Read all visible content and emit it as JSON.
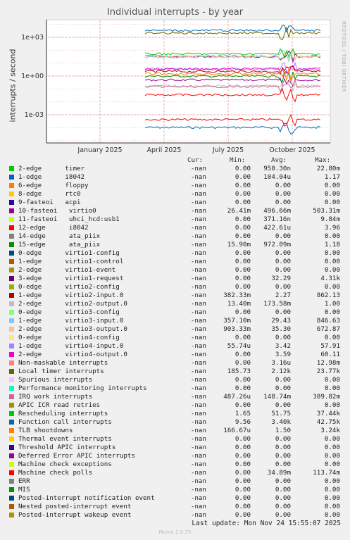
{
  "title": "Individual interrupts - by year",
  "side_label": "RRDTOOL / TOBI OETIKER",
  "footer": "Last update: Mon Nov 24 15:55:07 2025",
  "version": "Munin 2.0.75",
  "legend_headers": {
    "cur": "Cur:",
    "min": "Min:",
    "avg": "Avg:",
    "max": "Max:"
  },
  "chart_data": {
    "type": "line",
    "title": "Individual interrupts - by year",
    "ylabel": "interrupts / second",
    "yscale": "log",
    "yticks": [
      "1e+03",
      "1e+00",
      "1e-03"
    ],
    "xticks": [
      "January 2025",
      "April 2025",
      "July 2025",
      "October 2025"
    ],
    "grid": true,
    "series": [
      {
        "name": "2-edge      timer",
        "color": "#00cc00",
        "cur": "-nan",
        "min": "0.00",
        "avg": "950.30n",
        "max": "22.80m"
      },
      {
        "name": "1-edge      i8042",
        "color": "#0066b3",
        "cur": "-nan",
        "min": "0.00",
        "avg": "104.04u",
        "max": "1.17"
      },
      {
        "name": "6-edge      floppy",
        "color": "#ff8000",
        "cur": "-nan",
        "min": "0.00",
        "avg": "0.00",
        "max": "0.00"
      },
      {
        "name": "8-edge      rtc0",
        "color": "#ffcc00",
        "cur": "-nan",
        "min": "0.00",
        "avg": "0.00",
        "max": "0.00"
      },
      {
        "name": "9-fasteoi   acpi",
        "color": "#330099",
        "cur": "-nan",
        "min": "0.00",
        "avg": "0.00",
        "max": "0.00"
      },
      {
        "name": "10-fasteoi   virtio0",
        "color": "#990099",
        "cur": "-nan",
        "min": "26.41m",
        "avg": "496.66m",
        "max": "503.31m"
      },
      {
        "name": "11-fasteoi   uhci_hcd:usb1",
        "color": "#ccff00",
        "cur": "-nan",
        "min": "0.00",
        "avg": "371.16n",
        "max": "9.84m"
      },
      {
        "name": "12-edge      i8042",
        "color": "#ff0000",
        "cur": "-nan",
        "min": "0.00",
        "avg": "422.61u",
        "max": "3.96"
      },
      {
        "name": "14-edge      ata_piix",
        "color": "#808080",
        "cur": "-nan",
        "min": "0.00",
        "avg": "0.00",
        "max": "0.00"
      },
      {
        "name": "15-edge      ata_piix",
        "color": "#008f00",
        "cur": "-nan",
        "min": "15.90m",
        "avg": "972.09m",
        "max": "1.18"
      },
      {
        "name": "0-edge      virtio1-config",
        "color": "#00487d",
        "cur": "-nan",
        "min": "0.00",
        "avg": "0.00",
        "max": "0.00"
      },
      {
        "name": "1-edge      virtio1-control",
        "color": "#b35a00",
        "cur": "-nan",
        "min": "0.00",
        "avg": "0.00",
        "max": "0.00"
      },
      {
        "name": "2-edge      virtio1-event",
        "color": "#b38f00",
        "cur": "-nan",
        "min": "0.00",
        "avg": "0.00",
        "max": "0.00"
      },
      {
        "name": "3-edge      virtio1-request",
        "color": "#6b006b",
        "cur": "-nan",
        "min": "0.00",
        "avg": "32.29",
        "max": "4.31k"
      },
      {
        "name": "0-edge      virtio2-config",
        "color": "#8fb300",
        "cur": "-nan",
        "min": "0.00",
        "avg": "0.00",
        "max": "0.00"
      },
      {
        "name": "1-edge      virtio2-input.0",
        "color": "#b30000",
        "cur": "-nan",
        "min": "382.33m",
        "avg": "2.27",
        "max": "862.13"
      },
      {
        "name": "2-edge      virtio2-output.0",
        "color": "#bebebe",
        "cur": "-nan",
        "min": "13.40m",
        "avg": "173.58m",
        "max": "1.00"
      },
      {
        "name": "0-edge      virtio3-config",
        "color": "#80ff80",
        "cur": "-nan",
        "min": "0.00",
        "avg": "0.00",
        "max": "0.00"
      },
      {
        "name": "1-edge      virtio3-input.0",
        "color": "#80c9ff",
        "cur": "-nan",
        "min": "357.10m",
        "avg": "29.43",
        "max": "846.63"
      },
      {
        "name": "2-edge      virtio3-output.0",
        "color": "#ffc080",
        "cur": "-nan",
        "min": "903.33m",
        "avg": "35.30",
        "max": "672.87"
      },
      {
        "name": "0-edge      virtio4-config",
        "color": "#ffe680",
        "cur": "-nan",
        "min": "0.00",
        "avg": "0.00",
        "max": "0.00"
      },
      {
        "name": "1-edge      virtio4-input.0",
        "color": "#aa80ff",
        "cur": "-nan",
        "min": "55.74u",
        "avg": "3.42",
        "max": "57.91"
      },
      {
        "name": "2-edge      virtio4-output.0",
        "color": "#ee00cc",
        "cur": "-nan",
        "min": "0.00",
        "avg": "3.59",
        "max": "60.11"
      },
      {
        "name": "Non-maskable interrupts",
        "color": "#ff8080",
        "cur": "-nan",
        "min": "0.00",
        "avg": "3.16u",
        "max": "12.98m"
      },
      {
        "name": "Local timer interrupts",
        "color": "#666600",
        "cur": "-nan",
        "min": "185.73",
        "avg": "2.12k",
        "max": "23.77k"
      },
      {
        "name": "Spurious interrupts",
        "color": "#ffbfff",
        "cur": "-nan",
        "min": "0.00",
        "avg": "0.00",
        "max": "0.00"
      },
      {
        "name": "Performance monitoring interrupts",
        "color": "#00ffcc",
        "cur": "-nan",
        "min": "0.00",
        "avg": "0.00",
        "max": "0.00"
      },
      {
        "name": "IRQ work interrupts",
        "color": "#cc6699",
        "cur": "-nan",
        "min": "487.26u",
        "avg": "148.74m",
        "max": "389.82m"
      },
      {
        "name": "APIC ICR read retries",
        "color": "#999900",
        "cur": "-nan",
        "min": "0.00",
        "avg": "0.00",
        "max": "0.00"
      },
      {
        "name": "Rescheduling interrupts",
        "color": "#00cc00",
        "cur": "-nan",
        "min": "1.65",
        "avg": "51.75",
        "max": "37.44k"
      },
      {
        "name": "Function call interrupts",
        "color": "#0066b3",
        "cur": "-nan",
        "min": "9.56",
        "avg": "3.40k",
        "max": "42.75k"
      },
      {
        "name": "TLB shootdowns",
        "color": "#ff8000",
        "cur": "-nan",
        "min": "166.67u",
        "avg": "1.50",
        "max": "3.24k"
      },
      {
        "name": "Thermal event interrupts",
        "color": "#ffcc00",
        "cur": "-nan",
        "min": "0.00",
        "avg": "0.00",
        "max": "0.00"
      },
      {
        "name": "Threshold APIC interrupts",
        "color": "#330099",
        "cur": "-nan",
        "min": "0.00",
        "avg": "0.00",
        "max": "0.00"
      },
      {
        "name": "Deferred Error APIC interrupts",
        "color": "#990099",
        "cur": "-nan",
        "min": "0.00",
        "avg": "0.00",
        "max": "0.00"
      },
      {
        "name": "Machine check exceptions",
        "color": "#ccff00",
        "cur": "-nan",
        "min": "0.00",
        "avg": "0.00",
        "max": "0.00"
      },
      {
        "name": "Machine check polls",
        "color": "#ff0000",
        "cur": "-nan",
        "min": "0.00",
        "avg": "34.89m",
        "max": "113.74m"
      },
      {
        "name": "ERR",
        "color": "#808080",
        "cur": "-nan",
        "min": "0.00",
        "avg": "0.00",
        "max": "0.00"
      },
      {
        "name": "MIS",
        "color": "#008f00",
        "cur": "-nan",
        "min": "0.00",
        "avg": "0.00",
        "max": "0.00"
      },
      {
        "name": "Posted-interrupt notification event",
        "color": "#00487d",
        "cur": "-nan",
        "min": "0.00",
        "avg": "0.00",
        "max": "0.00"
      },
      {
        "name": "Nested posted-interrupt event",
        "color": "#b35a00",
        "cur": "-nan",
        "min": "0.00",
        "avg": "0.00",
        "max": "0.00"
      },
      {
        "name": "Posted-interrupt wakeup event",
        "color": "#b38f00",
        "cur": "-nan",
        "min": "0.00",
        "avg": "0.00",
        "max": "0.00"
      }
    ]
  }
}
